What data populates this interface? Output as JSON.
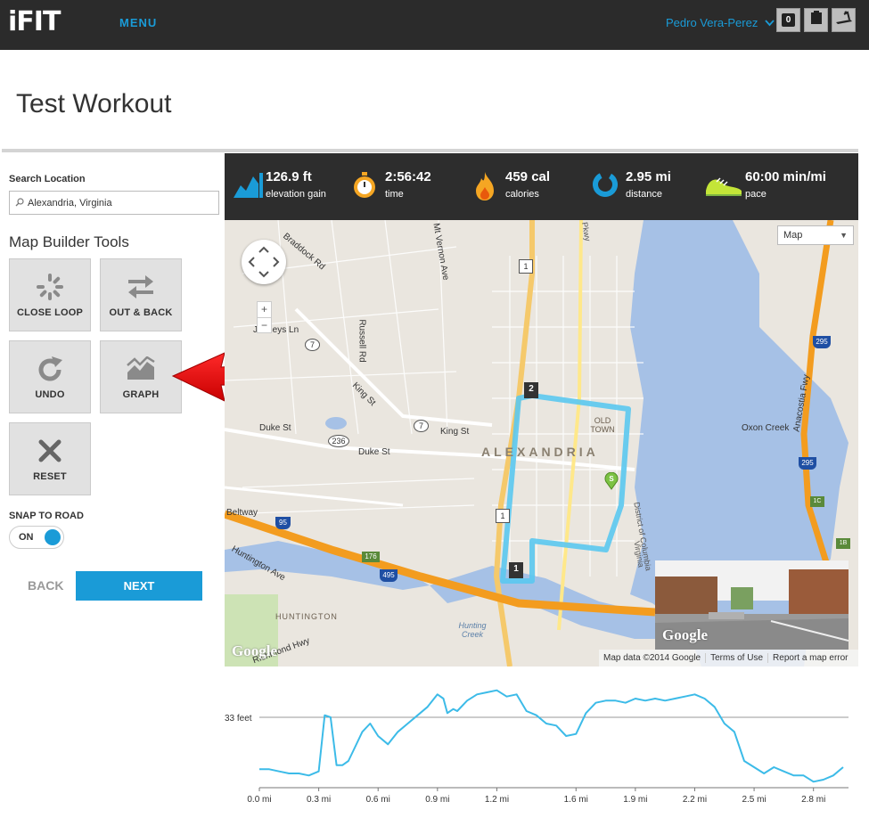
{
  "header": {
    "logo": "iFIT",
    "menu_label": "MENU",
    "user_name": "Pedro Vera-Perez",
    "cart_count": "0"
  },
  "page": {
    "title": "Test Workout"
  },
  "sidebar": {
    "search_label": "Search Location",
    "search_value": "Alexandria, Virginia",
    "tools_heading": "Map Builder Tools",
    "tools": [
      {
        "label": "CLOSE LOOP",
        "icon": "close-loop-icon"
      },
      {
        "label": "OUT & BACK",
        "icon": "out-back-icon"
      },
      {
        "label": "UNDO",
        "icon": "undo-icon"
      },
      {
        "label": "GRAPH",
        "icon": "graph-icon"
      },
      {
        "label": "RESET",
        "icon": "reset-icon"
      }
    ],
    "snap_label": "SNAP TO ROAD",
    "snap_state": "ON",
    "back_label": "BACK",
    "next_label": "NEXT"
  },
  "stats": [
    {
      "value": "126.9 ft",
      "label": "elevation gain",
      "icon": "elevation-icon"
    },
    {
      "value": "2:56:42",
      "label": "time",
      "icon": "stopwatch-icon"
    },
    {
      "value": "459 cal",
      "label": "calories",
      "icon": "flame-icon"
    },
    {
      "value": "2.95 mi",
      "label": "distance",
      "icon": "distance-icon"
    },
    {
      "value": "60:00 min/mi",
      "label": "pace",
      "icon": "shoe-icon"
    }
  ],
  "map": {
    "type_select": "Map",
    "google_label": "Google",
    "streetview_google_label": "Google",
    "attribution": [
      "Map data ©2014 Google",
      "Terms of Use",
      "Report a map error"
    ],
    "labels": {
      "alexandria": "ALEXANDRIA",
      "old_town": "OLD TOWN",
      "huntington": "HUNTINGTON",
      "duke_st_1": "Duke St",
      "duke_st_2": "Duke St",
      "king_st_1": "King St",
      "king_st_2": "King St",
      "beltway": "Beltway",
      "huntington_ave": "Huntington Ave",
      "russell_rd": "Russell Rd",
      "braddock_rd": "Braddock Rd",
      "mt_vernon_ave": "Mt Vernon Ave",
      "janneys_ln": "Janneys Ln",
      "oxon_creek": "Oxon Creek",
      "anacostia_fwy": "Anacostia Fwy",
      "hunting_creek": "Hunting Creek",
      "richmond_hwy": "Richmond Hwy",
      "district_of_columbia": "District of Columbia",
      "virginia": "Virginia",
      "pkwy": "Pkwy"
    },
    "markers": {
      "start": "S",
      "wp1": "1",
      "wp2": "2"
    },
    "shields": {
      "r7a": "7",
      "r7b": "7",
      "r236": "236",
      "r1a": "1",
      "r1b": "1",
      "i95": "95",
      "i495": "495",
      "r176": "176",
      "i295a": "295",
      "i295b": "295",
      "r1c": "1C",
      "r1b2": "1B"
    }
  },
  "chart_data": {
    "type": "line",
    "title": "",
    "xlabel": "",
    "ylabel": "",
    "y_reference_label": "33 feet",
    "y_reference_value": 33,
    "ylim": [
      0,
      48
    ],
    "xlim": [
      0,
      2.95
    ],
    "x_ticks": [
      "0.0 mi",
      "0.3 mi",
      "0.6 mi",
      "0.9 mi",
      "1.2 mi",
      "1.6 mi",
      "1.9 mi",
      "2.2 mi",
      "2.5 mi",
      "2.8 mi"
    ],
    "x_tick_values": [
      0,
      0.3,
      0.6,
      0.9,
      1.2,
      1.6,
      1.9,
      2.2,
      2.5,
      2.8
    ],
    "series": [
      {
        "x": [
          0.0,
          0.05,
          0.1,
          0.15,
          0.2,
          0.25,
          0.3,
          0.33,
          0.36,
          0.39,
          0.42,
          0.45,
          0.48,
          0.52,
          0.56,
          0.6,
          0.65,
          0.7,
          0.75,
          0.8,
          0.85,
          0.9,
          0.93,
          0.95,
          0.98,
          1.0,
          1.05,
          1.1,
          1.15,
          1.2,
          1.25,
          1.3,
          1.35,
          1.4,
          1.45,
          1.5,
          1.55,
          1.6,
          1.65,
          1.7,
          1.75,
          1.8,
          1.85,
          1.9,
          1.95,
          2.0,
          2.05,
          2.1,
          2.15,
          2.2,
          2.25,
          2.3,
          2.35,
          2.4,
          2.45,
          2.5,
          2.55,
          2.6,
          2.65,
          2.7,
          2.75,
          2.8,
          2.85,
          2.9,
          2.95
        ],
        "y": [
          8,
          8,
          7,
          6,
          6,
          5,
          7,
          34,
          33,
          10,
          10,
          12,
          18,
          26,
          30,
          24,
          20,
          26,
          30,
          34,
          38,
          44,
          42,
          35,
          37,
          36,
          41,
          44,
          45,
          46,
          43,
          44,
          36,
          34,
          30,
          29,
          24,
          25,
          35,
          40,
          41,
          41,
          40,
          42,
          41,
          42,
          41,
          42,
          43,
          44,
          42,
          38,
          30,
          26,
          12,
          9,
          6,
          9,
          7,
          5,
          5,
          2,
          3,
          5,
          9
        ]
      }
    ]
  }
}
